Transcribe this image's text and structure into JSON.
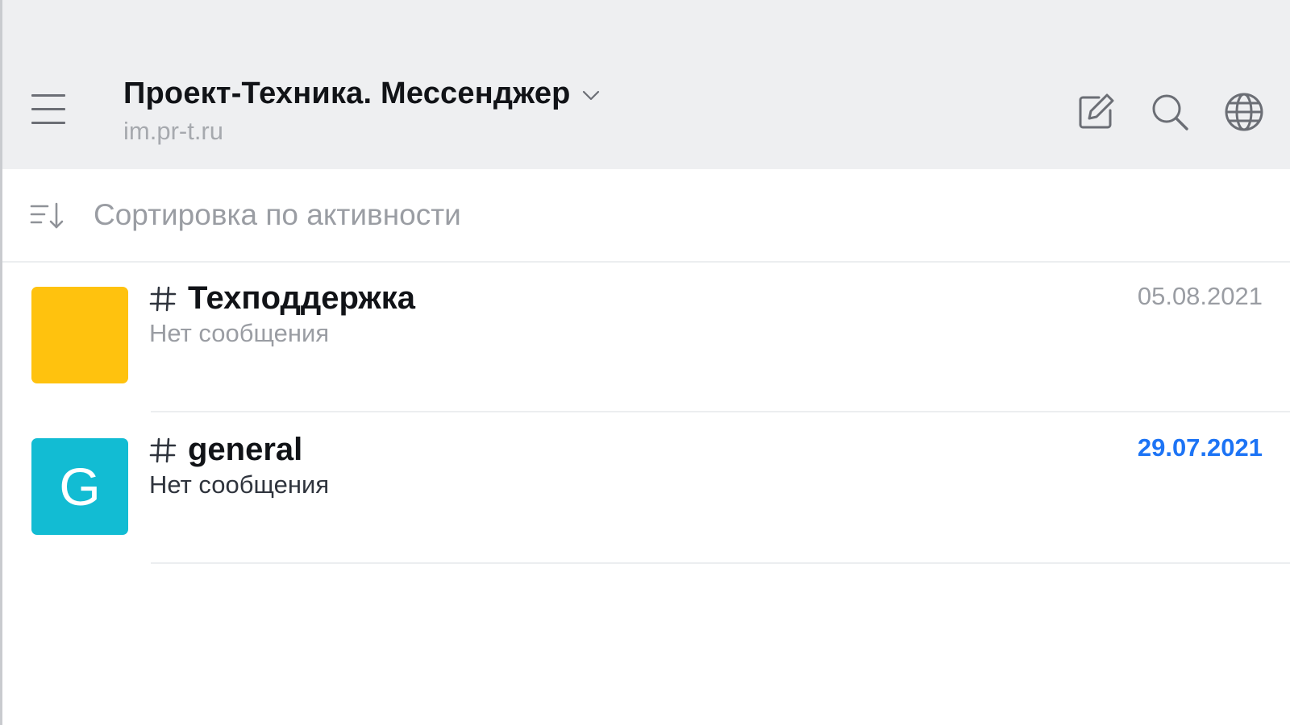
{
  "header": {
    "server_name": "Проект-Техника. Мессенджер",
    "server_url": "im.pr-t.ru",
    "icons": [
      "menu-icon",
      "chevron-down-icon",
      "edit-icon",
      "search-icon",
      "globe-icon"
    ]
  },
  "sort": {
    "label": "Сортировка по активности",
    "icon": "sort-icon"
  },
  "rooms": [
    {
      "name": "Техподдержка",
      "last_message": "Нет сообщения",
      "date": "05.08.2021",
      "avatar_letter": "",
      "avatar_color": "#ffc20e",
      "date_color": "#9a9da3",
      "message_color": "#9a9da3",
      "unread": false
    },
    {
      "name": "general",
      "last_message": "Нет сообщения",
      "date": "29.07.2021",
      "avatar_letter": "G",
      "avatar_color": "#12bcd3",
      "date_color": "#1d74f5",
      "message_color": "#2f343d",
      "unread": true
    }
  ],
  "colors": {
    "header_bg": "#eeeff1",
    "accent": "#1d74f5",
    "title": "#111317",
    "muted": "#9a9da3"
  }
}
